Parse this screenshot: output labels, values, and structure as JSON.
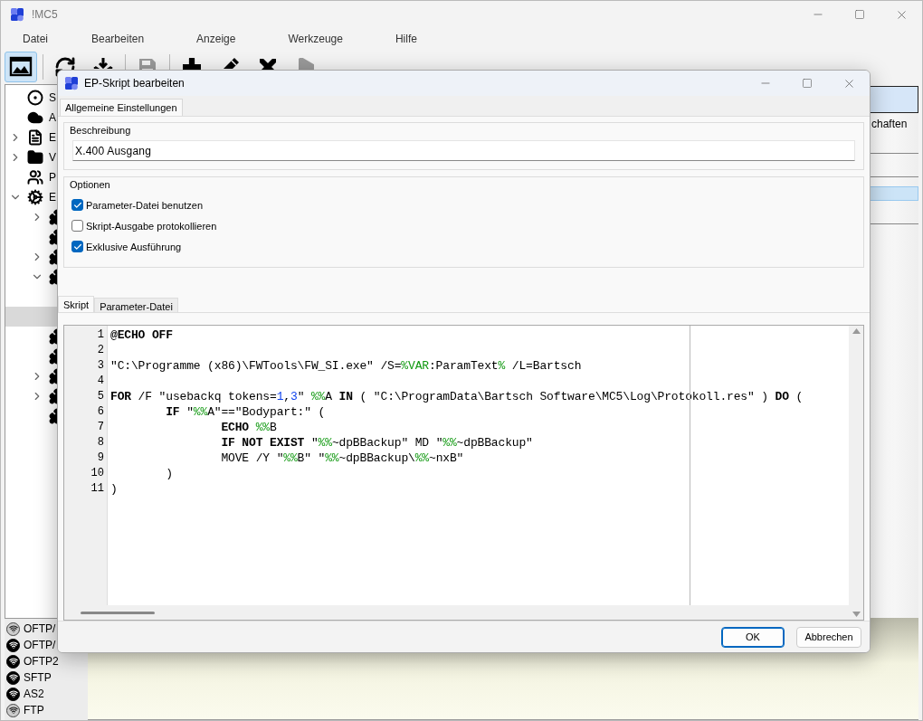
{
  "window": {
    "title": "!MC5"
  },
  "menu": [
    "Datei",
    "Bearbeiten",
    "Anzeige",
    "Werkzeuge",
    "Hilfe"
  ],
  "toolbar": [
    {
      "kind": "layout",
      "selected": true,
      "disabled": false
    },
    {
      "kind": "cloud",
      "selected": false,
      "disabled": false
    },
    {
      "kind": "download",
      "selected": false,
      "disabled": false
    },
    {
      "kind": "save",
      "selected": false,
      "disabled": true
    },
    {
      "kind": "add",
      "selected": false,
      "disabled": false
    },
    {
      "kind": "edit",
      "selected": false,
      "disabled": false
    },
    {
      "kind": "delete",
      "selected": false,
      "disabled": false
    },
    {
      "kind": "run",
      "selected": false,
      "disabled": true
    }
  ],
  "tree": [
    {
      "kind": "target",
      "label": "S",
      "selected": false
    },
    {
      "kind": "cloud",
      "label": "A",
      "selected": false
    },
    {
      "kind": "document",
      "label": "E",
      "expanded": false,
      "selected": false
    },
    {
      "kind": "folder",
      "label": "V",
      "expanded": false,
      "selected": false
    },
    {
      "kind": "users",
      "label": "P",
      "selected": false
    },
    {
      "kind": "gears",
      "label": "E",
      "expanded": true,
      "selected": false,
      "children": [
        {
          "kind": "puzzle",
          "expanded": false,
          "selected": false
        },
        {
          "kind": "puzzle",
          "selected": false
        },
        {
          "kind": "puzzle",
          "expanded": false,
          "selected": false
        },
        {
          "kind": "puzzle",
          "expanded": true,
          "selected": false,
          "children": [
            {
              "selected": false
            },
            {
              "selected": true
            }
          ]
        },
        {
          "kind": "puzzle",
          "selected": false
        },
        {
          "kind": "puzzle",
          "selected": false
        },
        {
          "kind": "puzzle",
          "expanded": false,
          "selected": false
        },
        {
          "kind": "puzzle",
          "expanded": false,
          "selected": false
        },
        {
          "kind": "puzzle",
          "selected": false
        }
      ]
    }
  ],
  "right_panel": {
    "heading": "chaften",
    "rows": [
      {
        "selected": false
      },
      {
        "selected": false
      },
      {
        "selected": true
      },
      {
        "selected": false
      }
    ]
  },
  "connections": [
    {
      "label": "OFTP/",
      "active": false
    },
    {
      "label": "OFTP/",
      "active": true
    },
    {
      "label": "OFTP2",
      "active": true
    },
    {
      "label": "SFTP",
      "active": true
    },
    {
      "label": "AS2",
      "active": true
    },
    {
      "label": "FTP",
      "active": false
    }
  ],
  "dialog": {
    "title": "EP-Skript bearbeiten",
    "tabs": [
      {
        "label": "Allgemeine Einstellungen",
        "selected": true
      }
    ],
    "description": {
      "label": "Beschreibung",
      "value": "X.400 Ausgang"
    },
    "options": {
      "label": "Optionen",
      "items": [
        {
          "label": "Parameter-Datei benutzen",
          "checked": true
        },
        {
          "label": "Skript-Ausgabe protokollieren",
          "checked": false
        },
        {
          "label": "Exklusive Ausführung",
          "checked": true
        }
      ]
    },
    "editor_tabs": [
      {
        "label": "Skript",
        "selected": true
      },
      {
        "label": "Parameter-Datei",
        "selected": false
      }
    ],
    "script": [
      {
        "number": "1",
        "tokens": [
          {
            "kind": "keyword",
            "text": "@ECHO OFF"
          }
        ]
      },
      {
        "number": "2"
      },
      {
        "number": "3",
        "tokens": [
          {
            "kind": "plain",
            "text": "\"C:\\Programme (x86)\\FWTools\\FW_SI.exe\" /S="
          },
          {
            "kind": "variable",
            "text": "%VAR"
          },
          {
            "kind": "plain",
            "text": ":ParamText"
          },
          {
            "kind": "variable",
            "text": "%"
          },
          {
            "kind": "plain",
            "text": " /L=Bartsch"
          }
        ]
      },
      {
        "number": "4"
      },
      {
        "number": "5",
        "tokens": [
          {
            "kind": "keyword",
            "text": "FOR"
          },
          {
            "kind": "plain",
            "text": " /F \"usebackq tokens="
          },
          {
            "kind": "number",
            "text": "1"
          },
          {
            "kind": "plain",
            "text": ","
          },
          {
            "kind": "number",
            "text": "3"
          },
          {
            "kind": "plain",
            "text": "\" "
          },
          {
            "kind": "variable",
            "text": "%%"
          },
          {
            "kind": "plain",
            "text": "A "
          },
          {
            "kind": "keyword",
            "text": "IN"
          },
          {
            "kind": "plain",
            "text": " ( \"C:\\ProgramData\\Bartsch Software\\MC5\\Log\\Protokoll.res\" ) "
          },
          {
            "kind": "keyword",
            "text": "DO"
          },
          {
            "kind": "plain",
            "text": " ("
          }
        ]
      },
      {
        "number": "6",
        "tokens": [
          {
            "kind": "keyword",
            "text": "        IF"
          },
          {
            "kind": "plain",
            "text": " \""
          },
          {
            "kind": "variable",
            "text": "%%"
          },
          {
            "kind": "plain",
            "text": "A\"==\"Bodypart:\" ("
          }
        ]
      },
      {
        "number": "7",
        "tokens": [
          {
            "kind": "keyword",
            "text": "                ECHO "
          },
          {
            "kind": "variable",
            "text": "%%"
          },
          {
            "kind": "plain",
            "text": "B"
          }
        ]
      },
      {
        "number": "8",
        "tokens": [
          {
            "kind": "keyword",
            "text": "                IF NOT EXIST"
          },
          {
            "kind": "plain",
            "text": " \""
          },
          {
            "kind": "variable",
            "text": "%%"
          },
          {
            "kind": "plain",
            "text": "~dpBBackup\" MD \""
          },
          {
            "kind": "variable",
            "text": "%%"
          },
          {
            "kind": "plain",
            "text": "~dpBBackup\""
          }
        ]
      },
      {
        "number": "9",
        "tokens": [
          {
            "kind": "plain",
            "text": "                MOVE /Y \""
          },
          {
            "kind": "variable",
            "text": "%%"
          },
          {
            "kind": "plain",
            "text": "B\" \""
          },
          {
            "kind": "variable",
            "text": "%%"
          },
          {
            "kind": "plain",
            "text": "~dpBBackup\\"
          },
          {
            "kind": "variable",
            "text": "%%"
          },
          {
            "kind": "plain",
            "text": "~nxB\""
          }
        ]
      },
      {
        "number": "10",
        "tokens": [
          {
            "kind": "plain",
            "text": "        )"
          }
        ]
      },
      {
        "number": "11",
        "tokens": [
          {
            "kind": "plain",
            "text": ")"
          }
        ]
      }
    ],
    "buttons": [
      {
        "label": "OK",
        "default": true
      },
      {
        "label": "Abbrechen",
        "default": false
      }
    ]
  }
}
